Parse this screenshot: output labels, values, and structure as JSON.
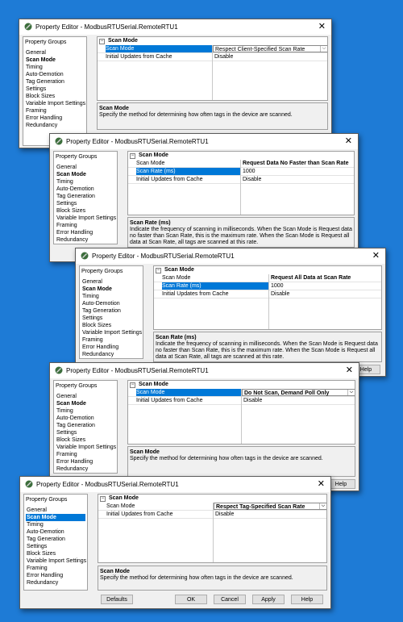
{
  "title": "Property Editor - ModbusRTUSerial.RemoteRTU1",
  "close_glyph": "✕",
  "groups_header": "Property Groups",
  "groups": [
    "General",
    "Scan Mode",
    "Timing",
    "Auto-Demotion",
    "Tag Generation",
    "Settings",
    "Block Sizes",
    "Variable Import Settings",
    "Framing",
    "Error Handling",
    "Redundancy"
  ],
  "category": "Scan Mode",
  "category_toggle": "−",
  "dropdown_glyph": "⌵",
  "prop_scan_mode": "Scan Mode",
  "prop_scan_rate": "Scan Rate (ms)",
  "prop_initial_updates": "Initial Updates from Cache",
  "value_disable": "Disable",
  "value_1000": "1000",
  "windows": [
    {
      "scan_mode_value": "Respect Client-Specified Scan Rate"
    },
    {
      "scan_mode_value": "Request Data No Faster than Scan Rate"
    },
    {
      "scan_mode_value": "Request All Data at Scan Rate"
    },
    {
      "scan_mode_value": "Do Not Scan, Demand Poll Only"
    },
    {
      "scan_mode_value": "Respect Tag-Specified Scan Rate"
    }
  ],
  "desc_scan_mode": {
    "title": "Scan Mode",
    "text": "Specify the method for determining how often tags in the device are scanned."
  },
  "desc_scan_rate": {
    "title": "Scan Rate (ms)",
    "text": "Indicate the frequency of scanning in milliseconds. When the Scan Mode is Request data no faster than Scan Rate, this is the maximum rate. When the Scan Mode is Request all data at Scan Rate, all tags are scanned at this rate."
  },
  "buttons": {
    "defaults": "Defaults",
    "ok": "OK",
    "cancel": "Cancel",
    "apply": "Apply",
    "help": "Help"
  },
  "colors": {
    "background": "#1e7bd6",
    "selection": "#0078d7"
  }
}
